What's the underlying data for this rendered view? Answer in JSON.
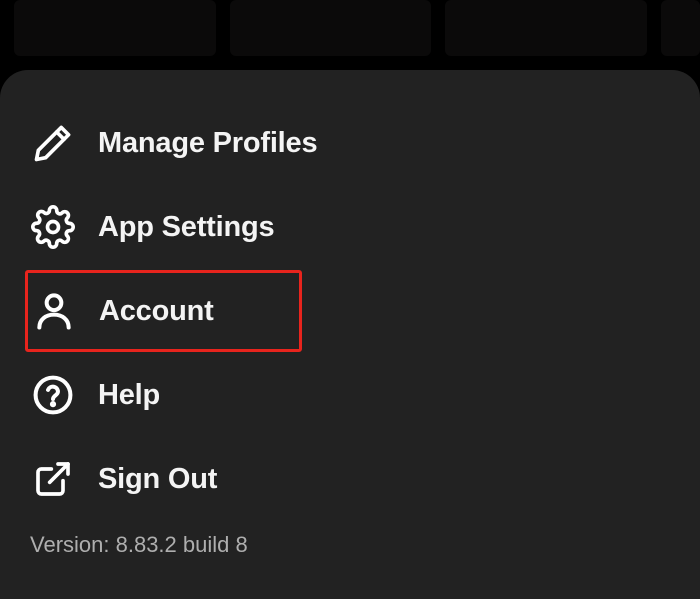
{
  "menu": {
    "items": [
      {
        "label": "Manage Profiles"
      },
      {
        "label": "App Settings"
      },
      {
        "label": "Account"
      },
      {
        "label": "Help"
      },
      {
        "label": "Sign Out"
      }
    ]
  },
  "footer": {
    "version": "Version: 8.83.2 build 8"
  }
}
